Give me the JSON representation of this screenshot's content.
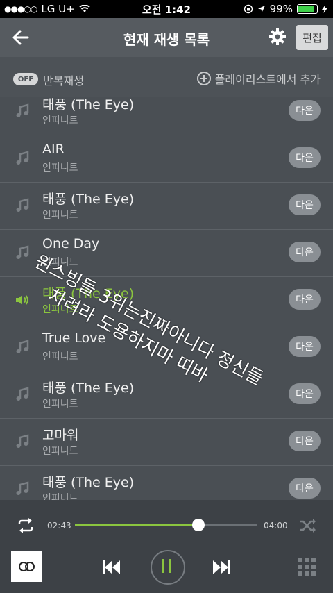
{
  "status": {
    "carrier": "LG U+",
    "time": "오전 1:42",
    "battery": "99%"
  },
  "header": {
    "title": "현재 재생 목록",
    "edit_label": "편집"
  },
  "options": {
    "toggle_label": "OFF",
    "repeat_label": "반복재생",
    "add_label": "플레이리스트에서 추가"
  },
  "songs": [
    {
      "title": "태풍 (The Eye)",
      "artist": "인피니트",
      "download": "다운"
    },
    {
      "title": "AIR",
      "artist": "인피니트",
      "download": "다운"
    },
    {
      "title": "태풍 (The Eye)",
      "artist": "인피니트",
      "download": "다운"
    },
    {
      "title": "One Day",
      "artist": "인피니트",
      "download": "다운"
    },
    {
      "title": "태풍 (The Eye)",
      "artist": "인피니트",
      "download": "다운"
    },
    {
      "title": "True Love",
      "artist": "인피니트",
      "download": "다운"
    },
    {
      "title": "태풍 (The Eye)",
      "artist": "인피니트",
      "download": "다운"
    },
    {
      "title": "고마워",
      "artist": "인피니트",
      "download": "다운"
    },
    {
      "title": "태풍 (The Eye)",
      "artist": "인피니트",
      "download": "다운"
    }
  ],
  "overlay_text": {
    "line1": "윈스빙들 3위는진짜아니다 정신들",
    "line2": "차려라 도용하지마 띠바"
  },
  "player": {
    "current_time": "02:43",
    "total_time": "04:00",
    "progress": 0.68
  },
  "colors": {
    "accent": "#8bc53f"
  }
}
